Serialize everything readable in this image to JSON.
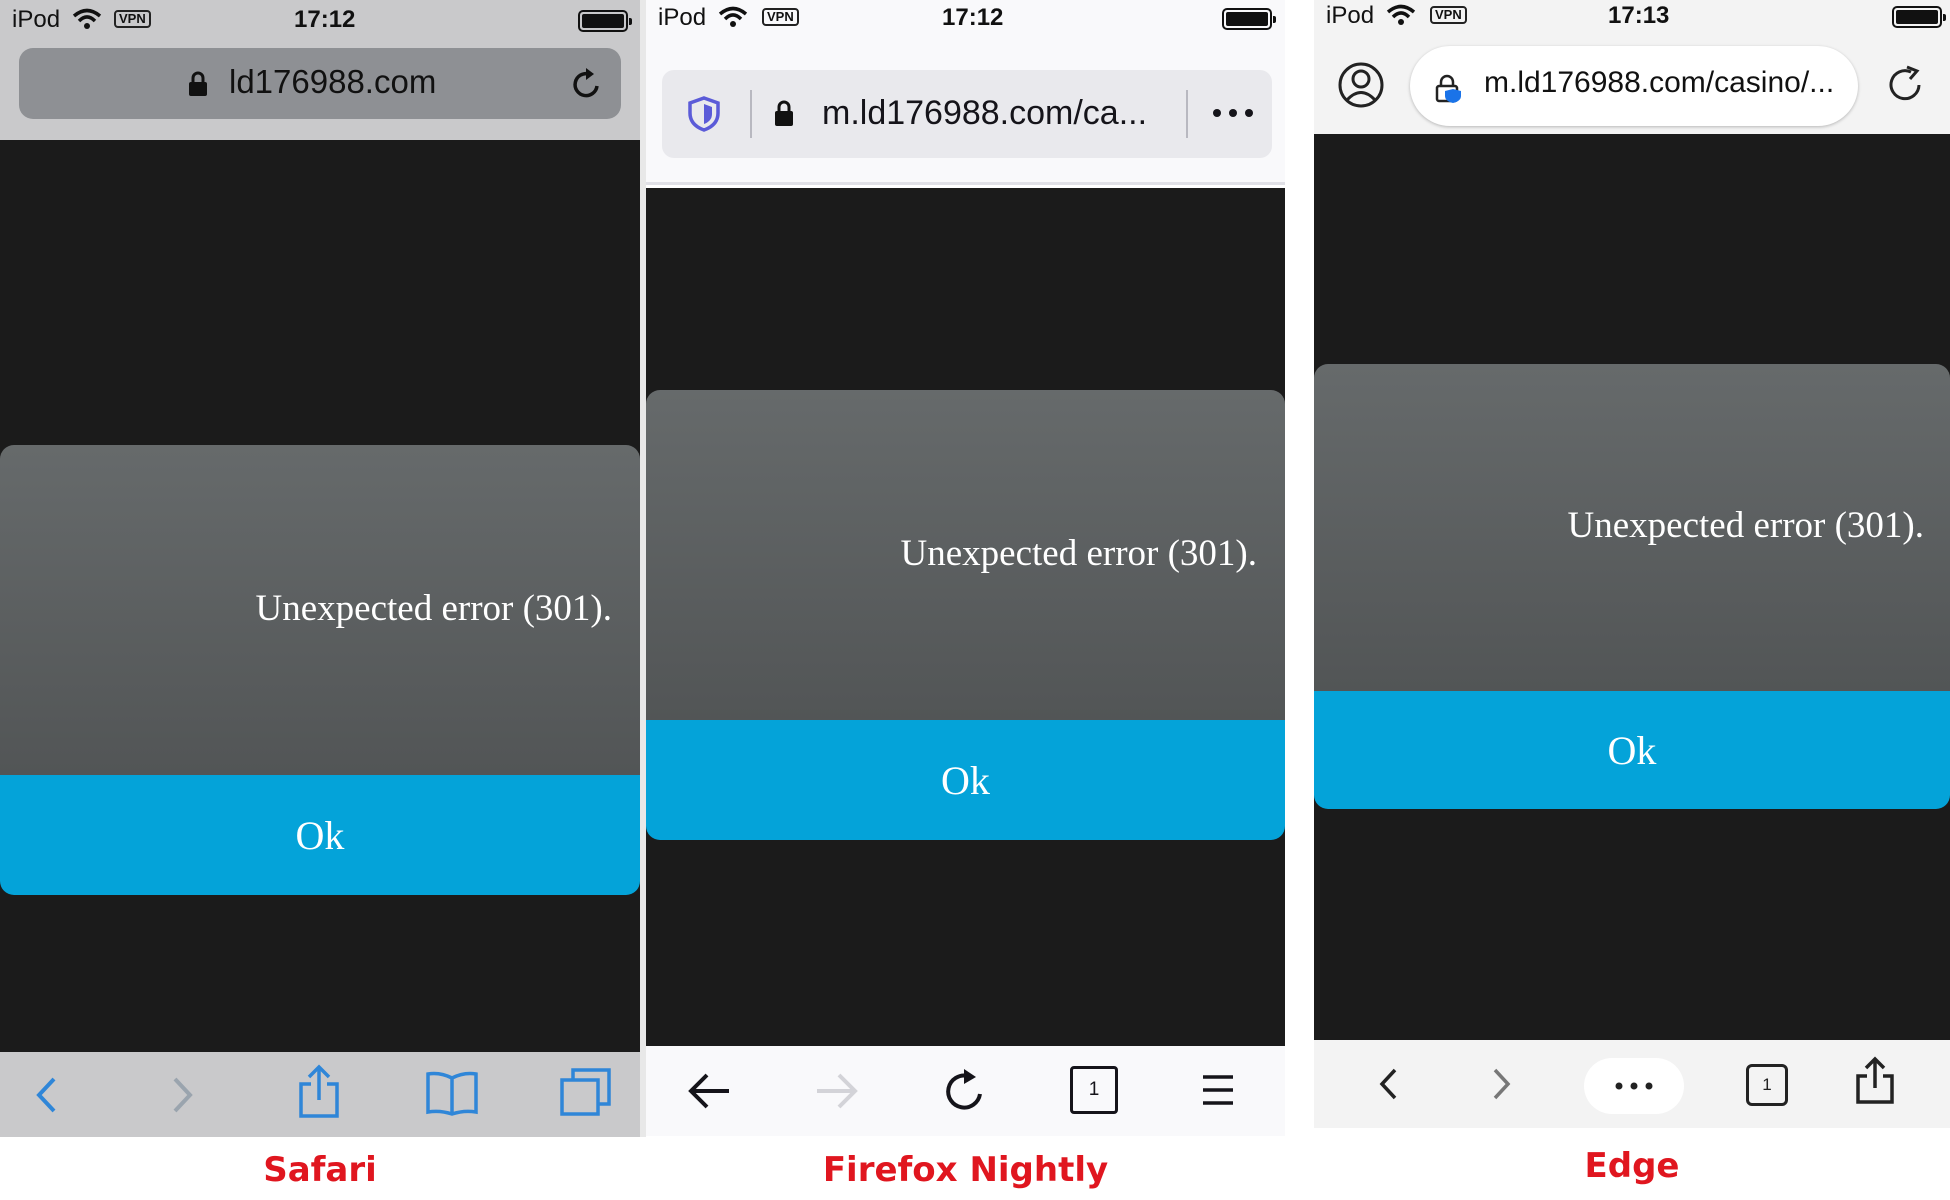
{
  "safari": {
    "status": {
      "carrier": "iPod",
      "vpn": "VPN",
      "time": "17:12"
    },
    "url": "ld176988.com",
    "dialog": {
      "message": "Unexpected error (301).",
      "button": "Ok"
    },
    "caption": "Safari"
  },
  "firefox": {
    "status": {
      "carrier": "iPod",
      "vpn": "VPN",
      "time": "17:12"
    },
    "url": "m.ld176988.com/ca...",
    "dialog": {
      "message": "Unexpected error (301).",
      "button": "Ok"
    },
    "tab_count": "1",
    "caption": "Firefox Nightly"
  },
  "edge": {
    "status": {
      "carrier": "iPod",
      "vpn": "VPN",
      "time": "17:13"
    },
    "url": "m.ld176988.com/casino/...",
    "dialog": {
      "message": "Unexpected error (301).",
      "button": "Ok"
    },
    "tab_count": "1",
    "caption": "Edge"
  },
  "colors": {
    "dark_bg": "#1b1b1b",
    "ok_button": "#04a3d9",
    "caption": "#e0161f",
    "safari_icons": "#2f86d8"
  }
}
